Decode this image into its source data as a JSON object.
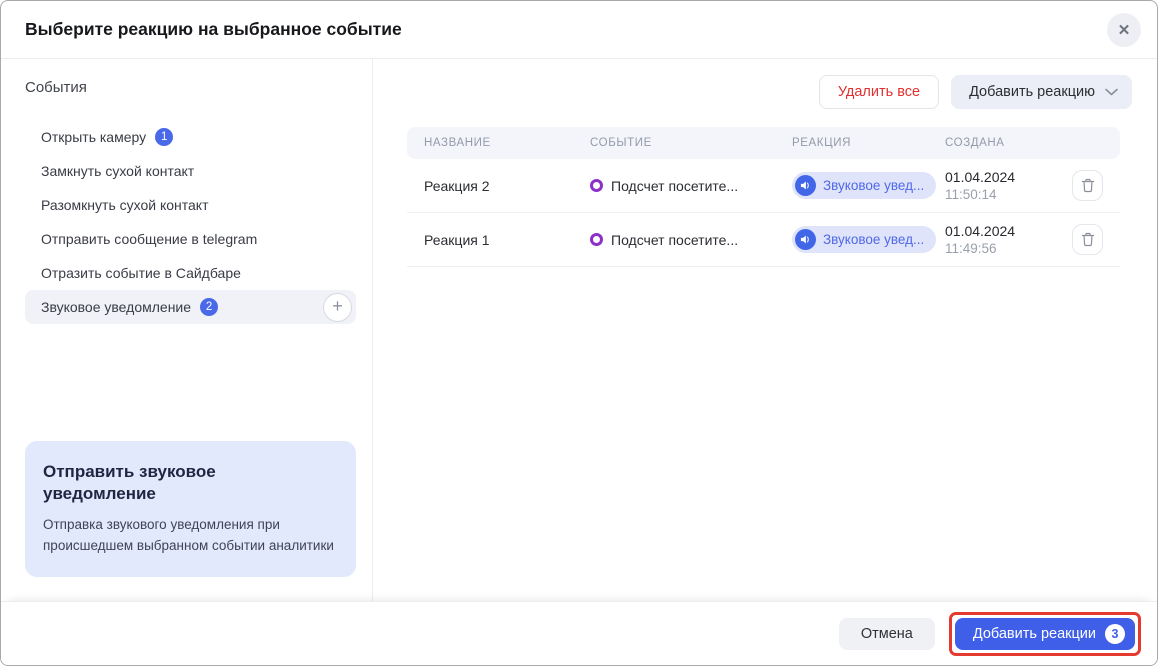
{
  "modal": {
    "title": "Выберите реакцию на выбранное событие"
  },
  "icons": {
    "close": "✕",
    "plus": "+"
  },
  "sidebar": {
    "heading": "События",
    "items": [
      {
        "label": "Открыть камеру",
        "badge": "1"
      },
      {
        "label": "Замкнуть сухой контакт"
      },
      {
        "label": "Разомкнуть сухой контакт"
      },
      {
        "label": "Отправить сообщение в telegram"
      },
      {
        "label": "Отразить событие в Сайдбаре"
      },
      {
        "label": "Звуковое уведомление",
        "badge": "2",
        "selected": true
      }
    ],
    "info_card": {
      "title": "Отправить звуковое уведомление",
      "description": "Отправка звукового уведомления при происшедшем выбранном событии аналитики"
    }
  },
  "toolbar": {
    "delete_all_label": "Удалить все",
    "add_reaction_label": "Добавить реакцию"
  },
  "table": {
    "headers": [
      "НАЗВАНИЕ",
      "СОБЫТИЕ",
      "РЕАКЦИЯ",
      "СОЗДАНА"
    ],
    "rows": [
      {
        "name": "Реакция 2",
        "event": "Подсчет посетите...",
        "reaction": "Звуковое увед...",
        "date": "01.04.2024",
        "time": "11:50:14"
      },
      {
        "name": "Реакция 1",
        "event": "Подсчет посетите...",
        "reaction": "Звуковое увед...",
        "date": "01.04.2024",
        "time": "11:49:56"
      }
    ]
  },
  "footer": {
    "cancel_label": "Отмена",
    "submit_label": "Добавить реакции",
    "submit_badge": "3"
  },
  "colors": {
    "accent_blue": "#4166e8",
    "danger_red": "#e03131",
    "annotation_red": "#e43a2f",
    "event_purple": "#8b31c9",
    "selected_bg": "#f0f2f8",
    "info_card_bg": "#e3e9fc"
  }
}
